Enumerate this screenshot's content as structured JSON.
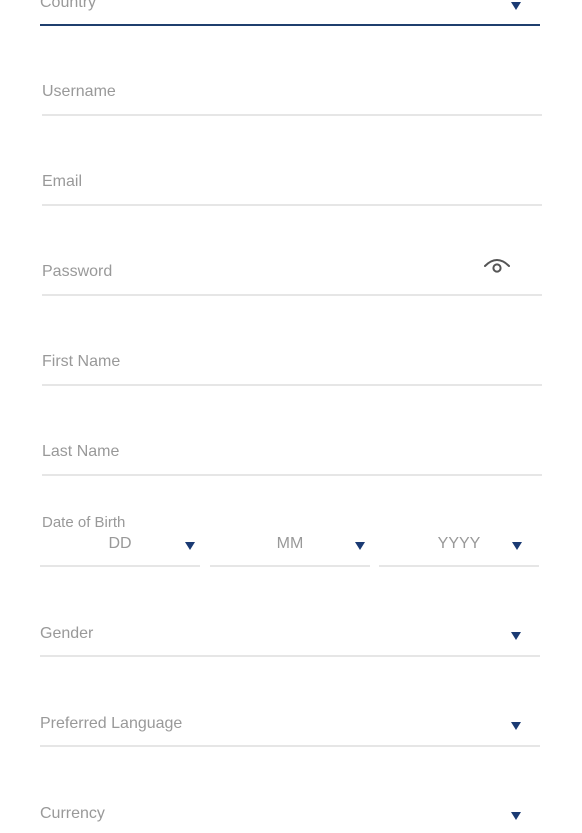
{
  "colors": {
    "accent": "#1a3a73",
    "active_underline": "#1f3f6e",
    "underline": "#e6e6e6",
    "label_text": "#999999"
  },
  "fields": {
    "country": {
      "label": "Country",
      "icon": "chevron-down-icon"
    },
    "username": {
      "label": "Username"
    },
    "email": {
      "label": "Email"
    },
    "password": {
      "label": "Password",
      "icon": "eye-icon"
    },
    "first_name": {
      "label": "First Name"
    },
    "last_name": {
      "label": "Last Name"
    },
    "dob": {
      "label": "Date of Birth",
      "day": "DD",
      "month": "MM",
      "year": "YYYY"
    },
    "gender": {
      "label": "Gender",
      "icon": "chevron-down-icon"
    },
    "preferred_language": {
      "label": "Preferred Language",
      "icon": "chevron-down-icon"
    },
    "currency": {
      "label": "Currency",
      "icon": "chevron-down-icon"
    }
  }
}
